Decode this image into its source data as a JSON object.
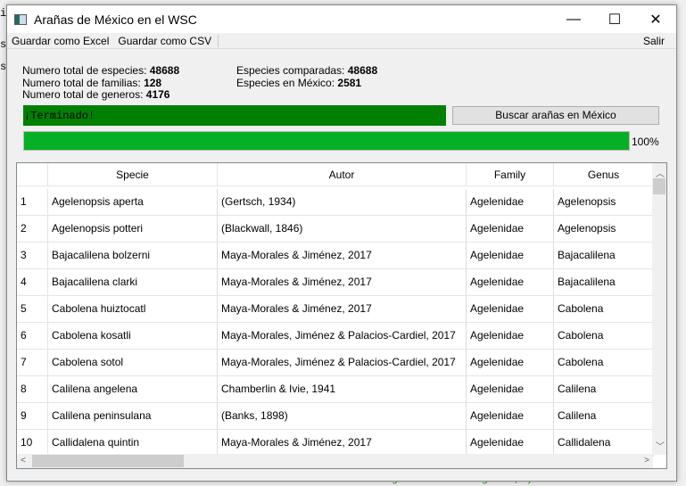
{
  "background": {
    "code_lines": [
      "i",
      "s",
      "s"
    ],
    "code_bottom": "background-color: green;\")"
  },
  "window": {
    "title": "Arañas de México en el WSC",
    "minimize": "—",
    "maximize": "☐",
    "close": "✕"
  },
  "menu": {
    "items": [
      "Guardar como Excel",
      "Guardar como CSV"
    ],
    "exit": "Salir"
  },
  "stats": {
    "species_label": "Numero total de especies:",
    "species": "48688",
    "families_label": "Numero total de familias:",
    "families": "128",
    "genera_label": "Numero total de generos:",
    "genera": "4176",
    "compared_label": "Especies comparadas:",
    "compared": "48688",
    "mexico_label": "Especies en México:",
    "mexico": "2581"
  },
  "status": {
    "text": "¡Terminado!",
    "color": "#008000"
  },
  "search_button": "Buscar arañas en México",
  "progress": {
    "percent": 100,
    "label": "100%",
    "color": "#06b025"
  },
  "table": {
    "columns": [
      "",
      "Specie",
      "Autor",
      "Family",
      "Genus"
    ],
    "rows": [
      [
        "1",
        "Agelenopsis aperta",
        "(Gertsch, 1934)",
        "Agelenidae",
        "Agelenopsis"
      ],
      [
        "2",
        "Agelenopsis potteri",
        "(Blackwall, 1846)",
        "Agelenidae",
        "Agelenopsis"
      ],
      [
        "3",
        "Bajacalilena bolzerni",
        "Maya-Morales & Jiménez, 2017",
        "Agelenidae",
        "Bajacalilena"
      ],
      [
        "4",
        "Bajacalilena clarki",
        "Maya-Morales & Jiménez, 2017",
        "Agelenidae",
        "Bajacalilena"
      ],
      [
        "5",
        "Cabolena huiztocatl",
        "Maya-Morales & Jiménez, 2017",
        "Agelenidae",
        "Cabolena"
      ],
      [
        "6",
        "Cabolena kosatli",
        "Maya-Morales, Jiménez & Palacios-Cardiel, 2017",
        "Agelenidae",
        "Cabolena"
      ],
      [
        "7",
        "Cabolena sotol",
        "Maya-Morales, Jiménez & Palacios-Cardiel, 2017",
        "Agelenidae",
        "Cabolena"
      ],
      [
        "8",
        "Calilena angelena",
        "Chamberlin & Ivie, 1941",
        "Agelenidae",
        "Calilena"
      ],
      [
        "9",
        "Calilena peninsulana",
        "(Banks, 1898)",
        "Agelenidae",
        "Calilena"
      ],
      [
        "10",
        "Callidalena quintin",
        "Maya-Morales & Jiménez, 2017",
        "Agelenidae",
        "Callidalena"
      ]
    ]
  }
}
